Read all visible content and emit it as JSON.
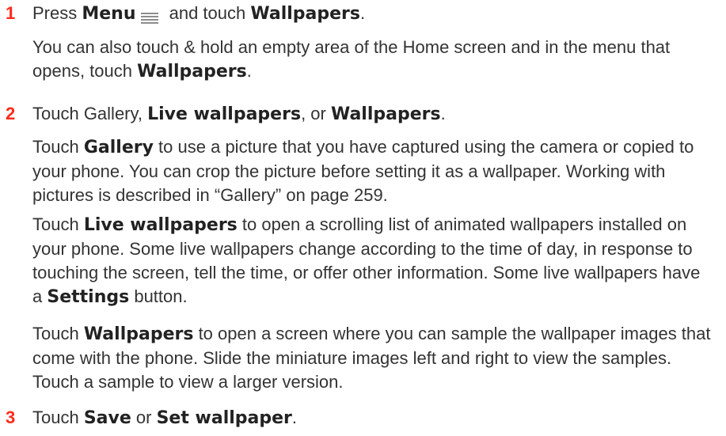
{
  "steps": [
    {
      "number": "1",
      "main": {
        "t1": "Press ",
        "b1": "Menu",
        "t2": " and touch ",
        "b2": "Wallpapers",
        "t3": "."
      },
      "icon": "menu-icon",
      "note": {
        "t1": "You can also touch & hold an empty area of the Home screen and in the menu that opens, touch ",
        "b1": "Wallpapers",
        "t2": "."
      }
    },
    {
      "number": "2",
      "main": {
        "t1": "Touch Gallery, ",
        "b1": "Live wallpapers",
        "t2": ", or ",
        "b2": "Wallpapers",
        "t3": "."
      },
      "para_gallery": {
        "t1": "Touch ",
        "b1": "Gallery",
        "t2": " to use a picture that you have captured using the camera or copied to your phone. You can crop the picture before setting it as a wallpaper. Working with pictures is described in “Gallery” on page 259."
      },
      "para_live": {
        "t1": "Touch ",
        "b1": "Live wallpapers",
        "t2": " to open a scrolling list of animated wallpapers installed on your phone. Some live wallpapers change according to the time of day, in response to touching the screen, tell the time, or offer other information. Some live wallpapers have a ",
        "b2": "Settings",
        "t3": " button."
      },
      "para_wallpapers": {
        "t1": "Touch ",
        "b1": "Wallpapers",
        "t2": " to open a screen where you can sample the wallpaper images that come with the phone. Slide the miniature images left and right to view the samples. Touch a sample to view a larger version."
      }
    },
    {
      "number": "3",
      "main": {
        "t1": "Touch ",
        "b1": "Save",
        "t2": " or ",
        "b2": "Set wallpaper",
        "t3": "."
      }
    }
  ],
  "colors": {
    "step_number": "#ff2a1b",
    "text": "#333333",
    "bold_text": "#222222",
    "background": "#ffffff"
  }
}
